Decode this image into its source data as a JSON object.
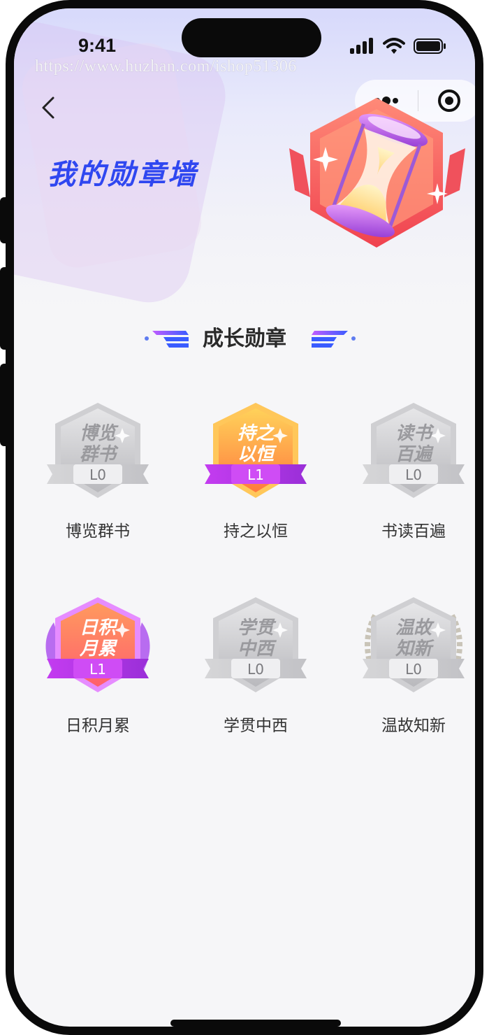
{
  "status_bar": {
    "time": "9:41"
  },
  "watermark": "https://www.huzhan.com/ishop51306",
  "nav": {
    "back_icon": "chevron-left-icon",
    "more_icon": "more-dots-icon",
    "target_icon": "record-icon"
  },
  "page": {
    "title": "我的勋章墙"
  },
  "section": {
    "title": "成长勋章"
  },
  "badges": [
    {
      "name": "博览群书",
      "face": [
        "博览",
        "群书"
      ],
      "level": "L0",
      "active": false
    },
    {
      "name": "持之以恒",
      "face": [
        "持之",
        "以恒"
      ],
      "level": "L1",
      "active": true
    },
    {
      "name": "书读百遍",
      "face": [
        "读书",
        "百遍"
      ],
      "level": "L0",
      "active": false
    },
    {
      "name": "日积月累",
      "face": [
        "日积",
        "月累"
      ],
      "level": "L1",
      "active": true
    },
    {
      "name": "学贯中西",
      "face": [
        "学贯",
        "中西"
      ],
      "level": "L0",
      "active": false
    },
    {
      "name": "温故知新",
      "face": [
        "温故",
        "知新"
      ],
      "level": "L0",
      "active": false
    }
  ],
  "colors": {
    "accent": "#2f47f0",
    "ribbon": "#b03bd6",
    "gold": "#f6b14a"
  }
}
